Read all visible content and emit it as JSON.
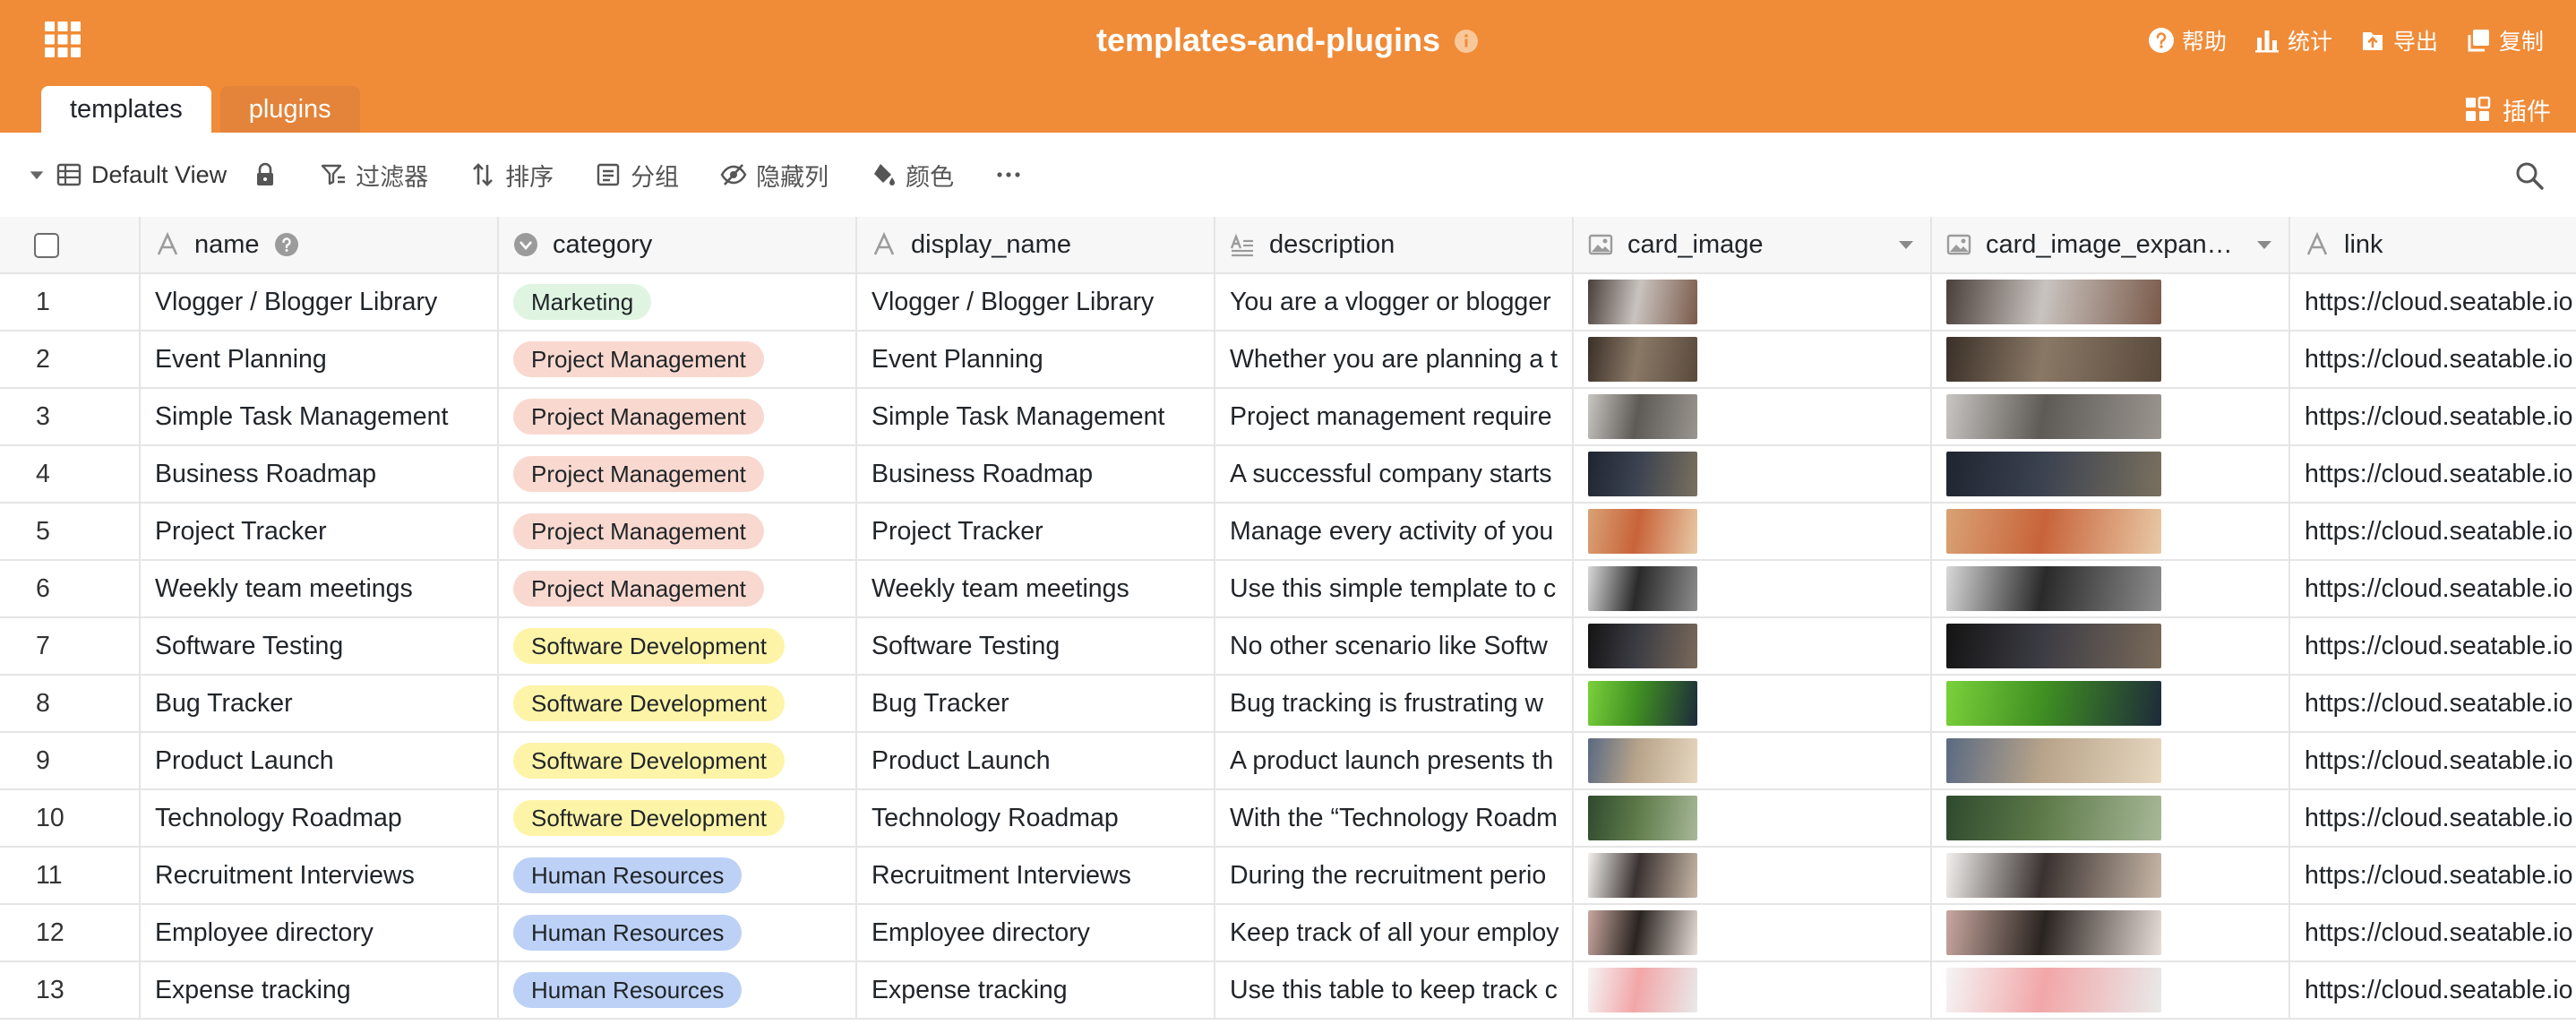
{
  "header": {
    "title": "templates-and-plugins",
    "actions": [
      {
        "label": "帮助",
        "icon": "question-icon"
      },
      {
        "label": "统计",
        "icon": "bar-chart-icon"
      },
      {
        "label": "导出",
        "icon": "export-icon"
      },
      {
        "label": "复制",
        "icon": "copy-icon"
      }
    ],
    "tabs": [
      {
        "label": "templates",
        "active": true
      },
      {
        "label": "plugins",
        "active": false
      }
    ],
    "plugins_label": "插件"
  },
  "toolbar": {
    "view_name": "Default View",
    "filter_label": "过滤器",
    "sort_label": "排序",
    "group_label": "分组",
    "hide_label": "隐藏列",
    "color_label": "颜色"
  },
  "columns": [
    {
      "label": "name",
      "icon": "text-icon"
    },
    {
      "label": "category",
      "icon": "single-select-icon"
    },
    {
      "label": "display_name",
      "icon": "text-icon"
    },
    {
      "label": "description",
      "icon": "long-text-icon"
    },
    {
      "label": "card_image",
      "icon": "image-icon"
    },
    {
      "label": "card_image_expand...",
      "icon": "image-icon"
    },
    {
      "label": "link",
      "icon": "text-icon"
    }
  ],
  "category_colors": {
    "Marketing": {
      "bg": "#dff5e1",
      "fg": "#212529"
    },
    "Project Management": {
      "bg": "#f9d9cf",
      "fg": "#212529"
    },
    "Software Development": {
      "bg": "#fdf4a8",
      "fg": "#212529"
    },
    "Human Resources": {
      "bg": "#bcd1f5",
      "fg": "#212529"
    }
  },
  "rows": [
    {
      "n": "1",
      "name": "Vlogger / Blogger Library",
      "category": "Marketing",
      "display_name": "Vlogger / Blogger Library",
      "description": "You are a vlogger or blogger",
      "link": "https://cloud.seatable.io",
      "img_colors": [
        "#4a3f3a",
        "#c9c3bf",
        "#7a5a4a"
      ]
    },
    {
      "n": "2",
      "name": "Event Planning",
      "category": "Project Management",
      "display_name": "Event Planning",
      "description": "Whether you are planning a t",
      "link": "https://cloud.seatable.io",
      "img_colors": [
        "#3a3028",
        "#8a7866",
        "#5a4a3c"
      ]
    },
    {
      "n": "3",
      "name": "Simple Task Management",
      "category": "Project Management",
      "display_name": "Simple Task Management",
      "description": "Project management require",
      "link": "https://cloud.seatable.io",
      "img_colors": [
        "#c8c6c2",
        "#5e5a56",
        "#9a958f"
      ]
    },
    {
      "n": "4",
      "name": "Business Roadmap",
      "category": "Project Management",
      "display_name": "Business Roadmap",
      "description": "A successful company starts",
      "link": "https://cloud.seatable.io",
      "img_colors": [
        "#1f2530",
        "#3b4250",
        "#7a705e"
      ]
    },
    {
      "n": "5",
      "name": "Project Tracker",
      "category": "Project Management",
      "display_name": "Project Tracker",
      "description": "Manage every activity of you",
      "link": "https://cloud.seatable.io",
      "img_colors": [
        "#d9a274",
        "#c8633a",
        "#e8c9a6"
      ]
    },
    {
      "n": "6",
      "name": "Weekly team meetings",
      "category": "Project Management",
      "display_name": "Weekly team meetings",
      "description": "Use this simple template to c",
      "link": "https://cloud.seatable.io",
      "img_colors": [
        "#d8d8d8",
        "#2a2a2a",
        "#8d8d8d"
      ]
    },
    {
      "n": "7",
      "name": "Software Testing",
      "category": "Software Development",
      "display_name": "Software Testing",
      "description": "No other scenario like Softw",
      "link": "https://cloud.seatable.io",
      "img_colors": [
        "#141414",
        "#3c3c44",
        "#7a6a5a"
      ]
    },
    {
      "n": "8",
      "name": "Bug Tracker",
      "category": "Software Development",
      "display_name": "Bug Tracker",
      "description": "Bug tracking is frustrating w",
      "link": "https://cloud.seatable.io",
      "img_colors": [
        "#7ad13a",
        "#3f8f22",
        "#1e2a3a"
      ]
    },
    {
      "n": "9",
      "name": "Product Launch",
      "category": "Software Development",
      "display_name": "Product Launch",
      "description": "A product launch presents th",
      "link": "https://cloud.seatable.io",
      "img_colors": [
        "#5a6a82",
        "#b8a48a",
        "#e7d7c0"
      ]
    },
    {
      "n": "10",
      "name": "Technology Roadmap",
      "category": "Software Development",
      "display_name": "Technology Roadmap",
      "description": "With the “Technology Roadm",
      "link": "https://cloud.seatable.io",
      "img_colors": [
        "#2e4a2e",
        "#5e7a4a",
        "#a8b898"
      ]
    },
    {
      "n": "11",
      "name": "Recruitment Interviews",
      "category": "Human Resources",
      "display_name": "Recruitment Interviews",
      "description": "During the recruitment perio",
      "link": "https://cloud.seatable.io",
      "img_colors": [
        "#f2f0ee",
        "#3a3230",
        "#c9b8a8"
      ]
    },
    {
      "n": "12",
      "name": "Employee directory",
      "category": "Human Resources",
      "display_name": "Employee directory",
      "description": "Keep track of all your employ",
      "link": "https://cloud.seatable.io",
      "img_colors": [
        "#c9a8a0",
        "#2a2420",
        "#e8ddd8"
      ]
    },
    {
      "n": "13",
      "name": "Expense tracking",
      "category": "Human Resources",
      "display_name": "Expense tracking",
      "description": "Use this table to keep track c",
      "link": "https://cloud.seatable.io",
      "img_colors": [
        "#f4f4f4",
        "#f2a6a8",
        "#e9e9e9"
      ]
    }
  ]
}
